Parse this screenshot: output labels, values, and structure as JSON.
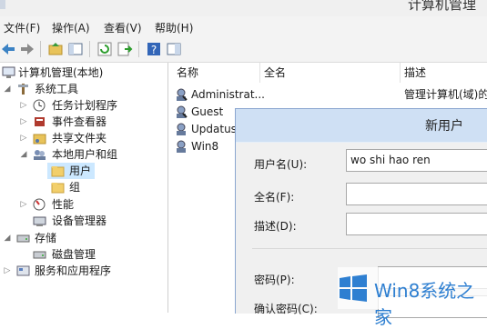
{
  "window": {
    "title": "计算机管理"
  },
  "menu": [
    "文件(F)",
    "操作(A)",
    "查看(V)",
    "帮助(H)"
  ],
  "toolbar": {
    "icons": [
      "back-arrow-icon",
      "forward-arrow-icon",
      "folder-up-icon",
      "console-tree-icon",
      "refresh-icon",
      "export-list-icon",
      "help-icon",
      "properties-pane-icon"
    ]
  },
  "tree": {
    "root": "计算机管理(本地)",
    "system_tools": "系统工具",
    "task_scheduler": "任务计划程序",
    "event_viewer": "事件查看器",
    "shared_folders": "共享文件夹",
    "local_users_groups": "本地用户和组",
    "users": "用户",
    "groups": "组",
    "performance": "性能",
    "device_manager": "设备管理器",
    "storage": "存储",
    "disk_management": "磁盘管理",
    "services_apps": "服务和应用程序"
  },
  "list": {
    "columns": [
      "名称",
      "全名",
      "描述"
    ],
    "rows": [
      {
        "name": "Administrat...",
        "description": "管理计算机(域)的"
      },
      {
        "name": "Guest"
      },
      {
        "name": "Updatus"
      },
      {
        "name": "Win8"
      }
    ]
  },
  "dialog": {
    "title": "新用户",
    "username_label": "用户名(U):",
    "username_value": "wo shi hao ren",
    "fullname_label": "全名(F):",
    "fullname_value": "",
    "description_label": "描述(D):",
    "description_value": "",
    "password_label": "密码(P):",
    "confirm_label": "确认密码(C):"
  },
  "watermark": {
    "text": "Win8系统之家"
  }
}
